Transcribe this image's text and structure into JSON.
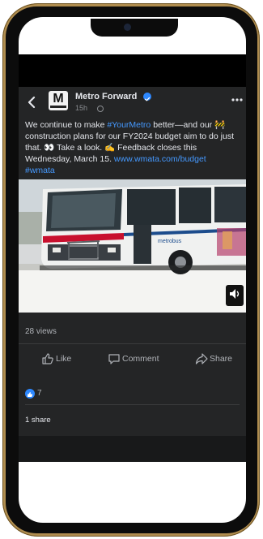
{
  "post": {
    "page_name": "Metro Forward",
    "time": "15h",
    "avatar_letter": "M",
    "caption_part1": "We continue to make ",
    "hashtag_yourmetro": "#YourMetro",
    "caption_part2": " better—and our 🚧 construction plans for our FY2024 budget aim to do just that. 👀 Take a look. ✍️ Feedback closes this Wednesday, March 15. ",
    "link": "www.wmata.com/budget",
    "hashtag_wmata": "#wmata",
    "views": "28 views",
    "like_label": "Like",
    "comment_label": "Comment",
    "share_label": "Share",
    "reaction_count": "7",
    "share_count": "1 share"
  },
  "media": {
    "bus_text": "metrobus"
  },
  "colors": {
    "accent": "#4599ff",
    "verified": "#2d88ff",
    "post_bg": "#242526",
    "frame_gold": "#b08d4f"
  },
  "icons": {
    "back": "chevron-left-icon",
    "verified": "verified-badge-icon",
    "globe": "globe-icon",
    "more": "more-options-icon",
    "like": "thumbs-up-icon",
    "comment": "comment-icon",
    "share": "share-arrow-icon",
    "reaction": "like-reaction-icon",
    "sound": "sound-icon"
  }
}
